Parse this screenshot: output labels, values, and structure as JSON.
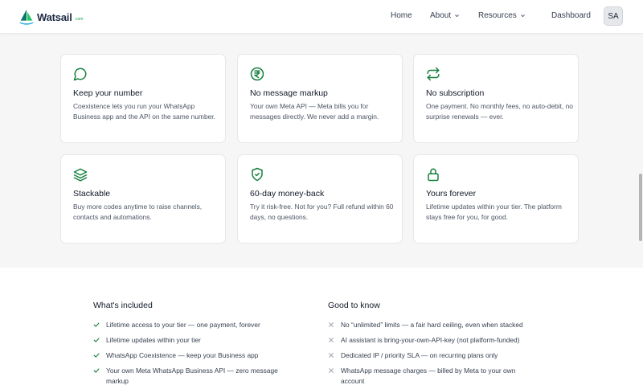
{
  "nav": {
    "logo_text": "Watsail",
    "logo_suffix": ".com",
    "links": {
      "home": "Home",
      "about": "About",
      "resources": "Resources",
      "dashboard": "Dashboard"
    },
    "avatar_initials": "SA"
  },
  "colors": {
    "accent": "#15803d",
    "cross": "#9ca3af",
    "band_bg": "#f6f6f7"
  },
  "cards": [
    {
      "icon": "chat-bubble-icon",
      "title": "Keep your number",
      "desc": "Coexistence lets you run your WhatsApp Business app and the API on the same number."
    },
    {
      "icon": "rupee-icon",
      "title": "No message markup",
      "desc": "Your own Meta API — Meta bills you for messages directly. We never add a margin."
    },
    {
      "icon": "repeat-icon",
      "title": "No subscription",
      "desc": "One payment. No monthly fees, no auto-debit, no surprise renewals — ever."
    },
    {
      "icon": "layers-icon",
      "title": "Stackable",
      "desc": "Buy more codes anytime to raise channels, contacts and automations."
    },
    {
      "icon": "shield-check-icon",
      "title": "60-day money-back",
      "desc": "Try it risk-free. Not for you? Full refund within 60 days, no questions."
    },
    {
      "icon": "lock-icon",
      "title": "Yours forever",
      "desc": "Lifetime updates within your tier. The platform stays free for you, for good."
    }
  ],
  "included": {
    "title": "What's included",
    "items": [
      "Lifetime access to your tier — one payment, forever",
      "Lifetime updates within your tier",
      "WhatsApp Coexistence — keep your Business app",
      "Your own Meta WhatsApp Business API — zero message markup"
    ]
  },
  "good_to_know": {
    "title": "Good to know",
    "items": [
      "No “unlimited” limits — a fair hard ceiling, even when stacked",
      "AI assistant is bring-your-own-API-key (not platform-funded)",
      "Dedicated IP / priority SLA — on recurring plans only",
      "WhatsApp message charges — billed by Meta to your own account"
    ]
  }
}
